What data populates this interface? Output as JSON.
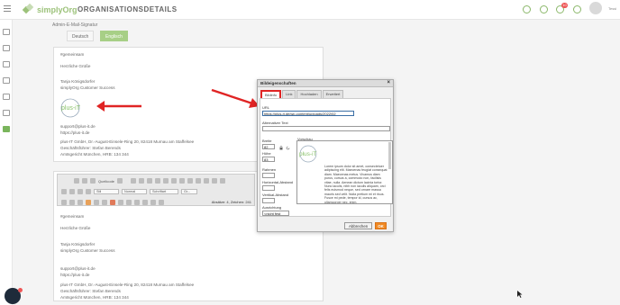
{
  "app": {
    "name": "simplyOrg",
    "page_title": "ORGANISATIONSDETAILS",
    "user_name": "Tessi",
    "notification_count": "10"
  },
  "content": {
    "field_label": "Admin-E-Mail-Signatur",
    "languages": [
      "Deutsch",
      "Englisch"
    ],
    "active_language": "Englisch"
  },
  "signature": {
    "hashtag": "#gemeinsam",
    "greeting": "Herzliche Grüße",
    "name": "Tanja Königsdorfer",
    "role": "simplyOrg Customer Success",
    "logo_text": "plus-iT",
    "email": "support@plus-it.de",
    "web": "https://plus-it.de",
    "company_line": "plus-IT GmbH, Dr.-August-Einsele-Ring 20, 82418 Murnau am Staffelsee",
    "manager_line": "Geschäftsführer: Stefan Berends",
    "register_line": "Amtsgericht München, HRB: 134 344"
  },
  "editor": {
    "source_label": "Quellcode",
    "style_select": "Stil",
    "format_select": "Normal",
    "font_select": "Schriftart",
    "size_select": "Gr...",
    "status": "Absätze: 4, Zeichen: 241"
  },
  "dialog": {
    "title": "Bildeigenschaften",
    "close": "×",
    "tabs": [
      "Bildinfo",
      "Link",
      "Hochladen",
      "Erweitert"
    ],
    "active_tab": "Bildinfo",
    "url_label": "URL",
    "url_value": "https://plus-it.de/wp-content/uploads/2022/02",
    "alt_label": "Alternativer Text",
    "alt_value": "",
    "width_label": "Breite",
    "width_value": "82",
    "height_label": "Höhe",
    "height_value": "83",
    "border_label": "Rahmen",
    "hspace_label": "Horizontal-Abstand",
    "vspace_label": "Vertikal-Abstand",
    "align_label": "Ausrichtung",
    "align_value": "<nicht fest",
    "preview_label": "Vorschau",
    "preview_text": "Lorem ipsum dolor sit amet, consectetuer adipiscing elit. Maecenas feugiat consequat diam. Maecenas metus. Vivamus diam purus, cursus a, commodo non, facilisis vitae, nulla. Aenean dictum lacinia tortor. Nunc iaculis, nibh non iaculis aliquam, orci felis euismod neque, sed ornare massa mauris sed velit. Nulla pretium mi et risus. Fusce mi pede, tempor id, cursus ac, ullamcorper nec, enim.",
    "cancel_label": "Abbrechen",
    "ok_label": "OK"
  },
  "colors": {
    "brand_green": "#7ab55c",
    "highlight_red": "#e02424",
    "ok_orange": "#f08a24",
    "link_blue": "#5b8bbd"
  },
  "icons": [
    "menu-icon",
    "user-info-icon",
    "help-icon",
    "bell-icon",
    "question-icon",
    "chat-icon",
    "arrow-icon",
    "lock-icon",
    "refresh-icon"
  ]
}
